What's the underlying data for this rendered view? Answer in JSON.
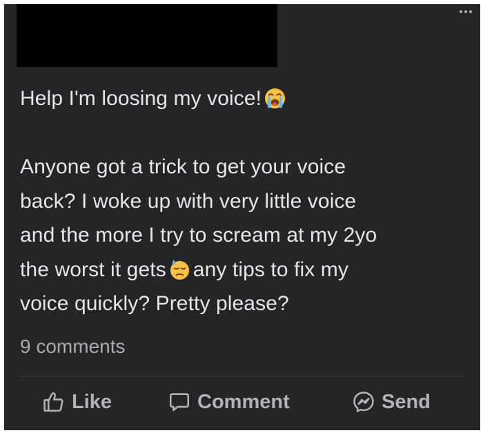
{
  "post": {
    "paragraphs": [
      "Help I'm loosing my voice!",
      "Anyone got a trick to get your voice back? I woke up with very little voice and the more I try to scream at my 2yo the worst it gets",
      "any tips to fix my voice quickly? Pretty please?"
    ],
    "line1": "Help I'm loosing my voice!",
    "line2": "Anyone got a trick to get your voice",
    "line3": "back? I woke up with very little voice",
    "line4": "and the more I try to scream at my 2yo",
    "line5a": "the worst it gets",
    "line5b": "any tips to fix my",
    "line6": "voice quickly? Pretty please?",
    "emoji1": "loudly-crying-face-emoji",
    "emoji2": "downcast-face-with-sweat-emoji"
  },
  "footer": {
    "comments_count": "9 comments"
  },
  "actions": {
    "like": "Like",
    "comment": "Comment",
    "send": "Send"
  },
  "icons": {
    "more": "more-options-icon",
    "like": "thumbs-up-icon",
    "comment": "comment-bubble-icon",
    "send": "messenger-icon"
  },
  "colors": {
    "card_background": "#242526",
    "text_primary": "#e4e6eb",
    "text_secondary": "#b0b3b8"
  }
}
